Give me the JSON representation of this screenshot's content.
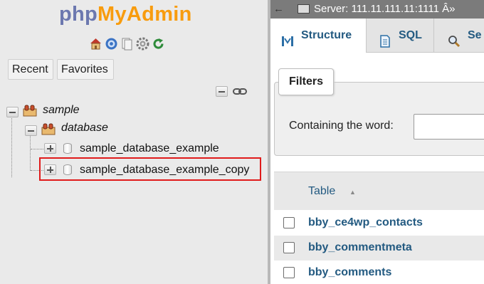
{
  "logo": {
    "part1": "php",
    "part2": "MyAdmin"
  },
  "nav_icons": [
    "home-icon",
    "help-icon",
    "docs-icon",
    "settings-icon",
    "reload-icon"
  ],
  "buttons": {
    "recent": "Recent",
    "favorites": "Favorites"
  },
  "tree": {
    "root": "sample",
    "database": "database",
    "items": [
      "sample_database_example",
      "sample_database_example_copy"
    ]
  },
  "server": {
    "arrow": "←",
    "label": "Server: 111.11.111.11:1111  Â»"
  },
  "tabs": {
    "structure": "Structure",
    "sql": "SQL",
    "search": "Se"
  },
  "filters": {
    "legend": "Filters",
    "label": "Containing the word:",
    "value": ""
  },
  "table": {
    "header": "Table",
    "sort_glyph": "▲",
    "rows": [
      "bby_ce4wp_contacts",
      "bby_commentmeta",
      "bby_comments"
    ]
  },
  "colors": {
    "highlight": "#e01b1b",
    "link": "#235a81",
    "logo_php": "#6c78af",
    "logo_myadmin": "#f89c0e"
  }
}
